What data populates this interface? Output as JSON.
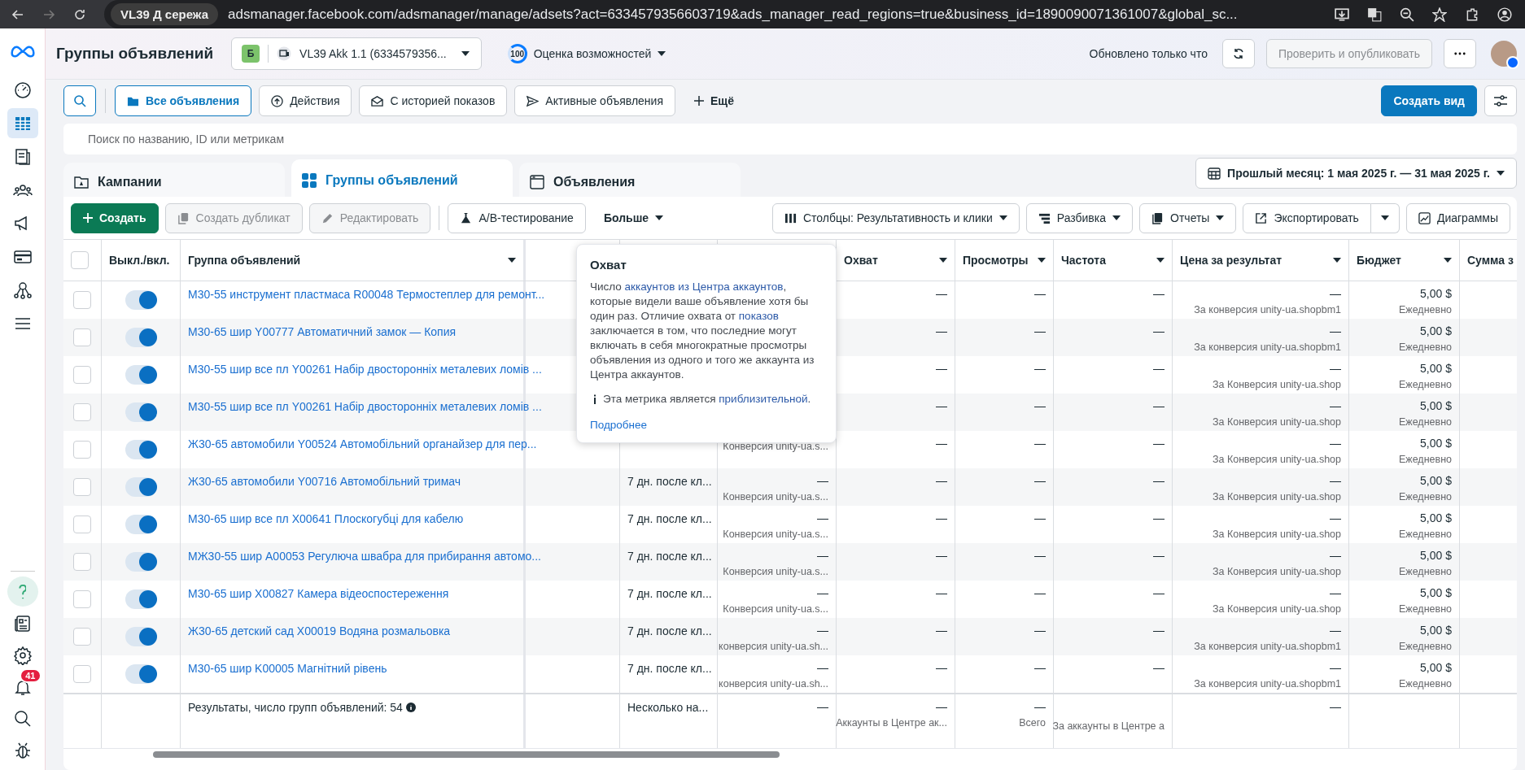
{
  "browser": {
    "profile": "VL39 Д сережа",
    "url": "adsmanager.facebook.com/adsmanager/manage/adsets?act=6334579356603719&ads_manager_read_regions=true&business_id=1890090071361007&global_sc..."
  },
  "sidebar": {
    "items": [
      {
        "kind": "gauge",
        "selected": false
      },
      {
        "kind": "table",
        "selected": true
      },
      {
        "kind": "pages",
        "selected": false
      },
      {
        "kind": "people",
        "selected": false
      },
      {
        "kind": "megaphone",
        "selected": false
      },
      {
        "kind": "card",
        "selected": false
      },
      {
        "kind": "network",
        "selected": false
      },
      {
        "kind": "menu",
        "selected": false
      }
    ],
    "bottom_items": [
      {
        "kind": "help"
      },
      {
        "kind": "news"
      },
      {
        "kind": "gear"
      },
      {
        "kind": "bell",
        "badge": "41"
      },
      {
        "kind": "search"
      },
      {
        "kind": "bug"
      }
    ]
  },
  "header": {
    "title": "Группы объявлений",
    "account": {
      "badge": "Б",
      "name": "VL39 Akk 1.1 (6334579356..."
    },
    "score": {
      "value": "100",
      "label": "Оценка возможностей"
    },
    "status": "Обновлено только что",
    "publish": {
      "label": "Проверить и опубликовать",
      "disabled": true
    }
  },
  "filters": {
    "chips": [
      {
        "label": "Все объявления",
        "kind": "folder",
        "selected": true
      },
      {
        "label": "Действия",
        "kind": "actions",
        "selected": false
      },
      {
        "label": "С историей показов",
        "kind": "mail",
        "selected": false
      },
      {
        "label": "Активные объявления",
        "kind": "send",
        "selected": false
      }
    ],
    "more": "Ещё",
    "create_view": "Создать вид"
  },
  "search": {
    "placeholder": "Поиск по названию, ID или метрикам"
  },
  "tabs": [
    {
      "label": "Кампании",
      "kind": "campaign",
      "selected": false
    },
    {
      "label": "Группы объявлений",
      "kind": "adsets",
      "selected": true
    },
    {
      "label": "Объявления",
      "kind": "ads",
      "selected": false
    }
  ],
  "date_range": "Прошлый месяц: 1 мая 2025 г. — 31 мая 2025 г.",
  "toolbar": {
    "create": "Создать",
    "actions": [
      {
        "label": "Создать дубликат",
        "kind": "duplicate",
        "disabled": true
      },
      {
        "label": "Редактировать",
        "kind": "edit",
        "disabled": true
      },
      {
        "label": "A/B-тестирование",
        "kind": "flask",
        "disabled": false
      }
    ],
    "more": "Больше",
    "right": [
      {
        "label": "Столбцы: Результативность и клики",
        "kind": "columns"
      },
      {
        "label": "Разбивка",
        "kind": "breakdown"
      },
      {
        "label": "Отчеты",
        "kind": "reports"
      }
    ],
    "export": "Экспортировать",
    "charts": "Диаграммы"
  },
  "table": {
    "select_all_checked": false,
    "columns": {
      "toggle": "Выкл./вкл.",
      "name": "Группа объявлений",
      "reach": "Охват",
      "views": "Просмотры",
      "frequency": "Частота",
      "cost": "Цена за результат",
      "budget": "Бюджет",
      "amount": "Сумма з"
    },
    "rows": [
      {
        "checked": false,
        "on": true,
        "name": "М30-55 инструмент пластмаса R00048 Термостеплер для ремонт...",
        "reach": "—",
        "views": "—",
        "frequency": "—",
        "cost": "—",
        "cost_sub": "За конверсия unity-ua.shopbm1",
        "budget": "5,00 $",
        "budget_sub": "Ежедневно"
      },
      {
        "checked": false,
        "on": true,
        "name": "М30-65 шир Y00777 Автоматичний замок — Копия",
        "reach": "—",
        "views": "—",
        "frequency": "—",
        "cost": "—",
        "cost_sub": "За конверсия unity-ua.shopbm1",
        "budget": "5,00 $",
        "budget_sub": "Ежедневно"
      },
      {
        "checked": false,
        "on": true,
        "name": "М30-55 шир все пл Y00261 Набір двосторонніх металевих ломів ...",
        "reach": "—",
        "views": "—",
        "frequency": "—",
        "cost": "—",
        "cost_sub": "За Конверсия unity-ua.shop",
        "budget": "5,00 $",
        "budget_sub": "Ежедневно"
      },
      {
        "checked": false,
        "on": true,
        "name": "М30-55 шир все пл Y00261 Набір двосторонніх металевих ломів ...",
        "reach": "—",
        "views": "—",
        "frequency": "—",
        "cost": "—",
        "cost_sub": "За Конверсия unity-ua.shop",
        "budget": "5,00 $",
        "budget_sub": "Ежедневно"
      },
      {
        "checked": false,
        "on": true,
        "name": "Ж30-65 автомобили Y00524 Автомобільний органайзер для пер...",
        "result_sub": "Конверсия unity-ua.s...",
        "reach": "—",
        "views": "—",
        "frequency": "—",
        "cost": "—",
        "cost_sub": "За Конверсия unity-ua.shop",
        "budget": "5,00 $",
        "budget_sub": "Ежедневно"
      },
      {
        "checked": false,
        "on": true,
        "name": "Ж30-65 автомобили Y00716 Автомобільний тримач",
        "attribution": "7 дн. после кл...",
        "result": "—",
        "result_sub": "Конверсия unity-ua.s...",
        "reach": "—",
        "views": "—",
        "frequency": "—",
        "cost": "—",
        "cost_sub": "За Конверсия unity-ua.shop",
        "budget": "5,00 $",
        "budget_sub": "Ежедневно"
      },
      {
        "checked": false,
        "on": true,
        "name": "М30-65 шир все пл X00641 Плоскогубці для кабелю",
        "attribution": "7 дн. после кл...",
        "result": "—",
        "result_sub": "Конверсия unity-ua.s...",
        "reach": "—",
        "views": "—",
        "frequency": "—",
        "cost": "—",
        "cost_sub": "За Конверсия unity-ua.shop",
        "budget": "5,00 $",
        "budget_sub": "Ежедневно"
      },
      {
        "checked": false,
        "on": true,
        "name": "МЖ30-55 шир A00053 Регулюча швабра для прибирання автомо...",
        "attribution": "7 дн. после кл...",
        "result": "—",
        "result_sub": "Конверсия unity-ua.s...",
        "reach": "—",
        "views": "—",
        "frequency": "—",
        "cost": "—",
        "cost_sub": "За Конверсия unity-ua.shop",
        "budget": "5,00 $",
        "budget_sub": "Ежедневно"
      },
      {
        "checked": false,
        "on": true,
        "name": "М30-65 шир X00827 Камера відеоспостереження",
        "attribution": "7 дн. после кл...",
        "result": "—",
        "result_sub": "Конверсия unity-ua.s...",
        "reach": "—",
        "views": "—",
        "frequency": "—",
        "cost": "—",
        "cost_sub": "За Конверсия unity-ua.shop",
        "budget": "5,00 $",
        "budget_sub": "Ежедневно"
      },
      {
        "checked": false,
        "on": true,
        "name": "Ж30-65 детский сад X00019 Водяна розмальовка",
        "attribution": "7 дн. после кл...",
        "result": "—",
        "result_sub": "конверсия unity-ua.sh...",
        "reach": "—",
        "views": "—",
        "frequency": "—",
        "cost": "—",
        "cost_sub": "За конверсия unity-ua.shopbm1",
        "budget": "5,00 $",
        "budget_sub": "Ежедневно"
      },
      {
        "checked": false,
        "on": true,
        "name": "М30-65 шир K00005 Магнітний рівень",
        "attribution": "7 дн. после кл...",
        "result": "—",
        "result_sub": "конверсия unity-ua.sh...",
        "reach": "—",
        "views": "—",
        "frequency": "—",
        "cost": "—",
        "cost_sub": "За конверсия unity-ua.shopbm1",
        "budget": "5,00 $",
        "budget_sub": "Ежедневно"
      }
    ],
    "footer": {
      "name": "Результаты, число групп объявлений: 54",
      "attribution": "Несколько на...",
      "result": "—",
      "reach": "—",
      "reach_sub": "Аккаунты в Центре ак...",
      "views": "—",
      "views_sub": "Всего",
      "frequency_sub": "За аккаунты в Центре а",
      "cost": "—"
    }
  },
  "tooltip": {
    "title": "Охват",
    "body": [
      {
        "text": "Число "
      },
      {
        "link": "аккаунтов из Центра аккаунтов"
      },
      {
        "text": ", которые видели ваше объявление хотя бы один раз. Отличие охвата от "
      },
      {
        "link": "показов"
      },
      {
        "text": " заключается в том, что последние могут включать в себя многократные просмотры объявления из одного и того же аккаунта из Центра аккаунтов."
      }
    ],
    "note": [
      {
        "text": "Эта метрика является "
      },
      {
        "link": "приблизительной"
      },
      {
        "text": "."
      }
    ],
    "more": "Подробнее"
  }
}
